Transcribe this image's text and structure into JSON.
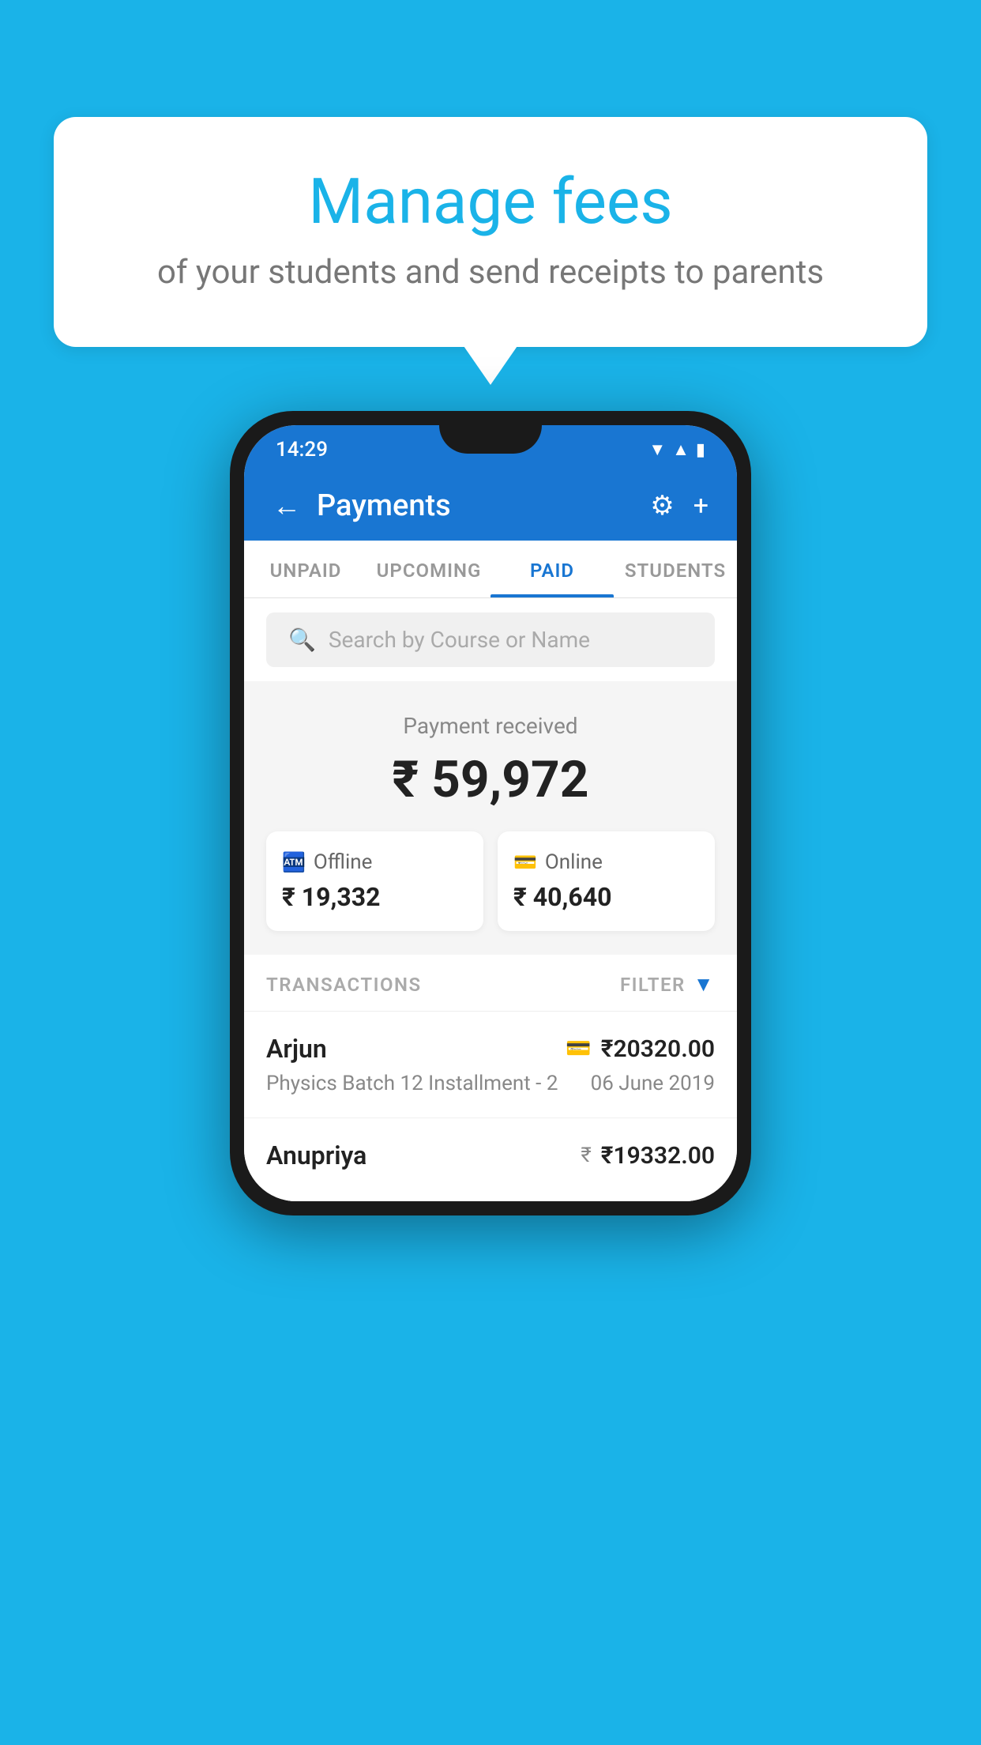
{
  "background_color": "#1ab3e8",
  "bubble": {
    "title": "Manage fees",
    "subtitle": "of your students and send receipts to parents"
  },
  "status_bar": {
    "time": "14:29",
    "signal_icon": "▲",
    "wifi_icon": "▼"
  },
  "app_bar": {
    "title": "Payments",
    "back_label": "←",
    "settings_label": "⚙",
    "add_label": "+"
  },
  "tabs": [
    {
      "label": "UNPAID",
      "active": false
    },
    {
      "label": "UPCOMING",
      "active": false
    },
    {
      "label": "PAID",
      "active": true
    },
    {
      "label": "STUDENTS",
      "active": false
    }
  ],
  "search": {
    "placeholder": "Search by Course or Name"
  },
  "payment_summary": {
    "label": "Payment received",
    "total": "₹ 59,972",
    "offline": {
      "type": "Offline",
      "amount": "₹ 19,332"
    },
    "online": {
      "type": "Online",
      "amount": "₹ 40,640"
    }
  },
  "transactions": {
    "header_label": "TRANSACTIONS",
    "filter_label": "FILTER",
    "items": [
      {
        "name": "Arjun",
        "amount": "₹20320.00",
        "course": "Physics Batch 12 Installment - 2",
        "date": "06 June 2019",
        "payment_type": "card"
      },
      {
        "name": "Anupriya",
        "amount": "₹19332.00",
        "course": "",
        "date": "",
        "payment_type": "rupee"
      }
    ]
  }
}
